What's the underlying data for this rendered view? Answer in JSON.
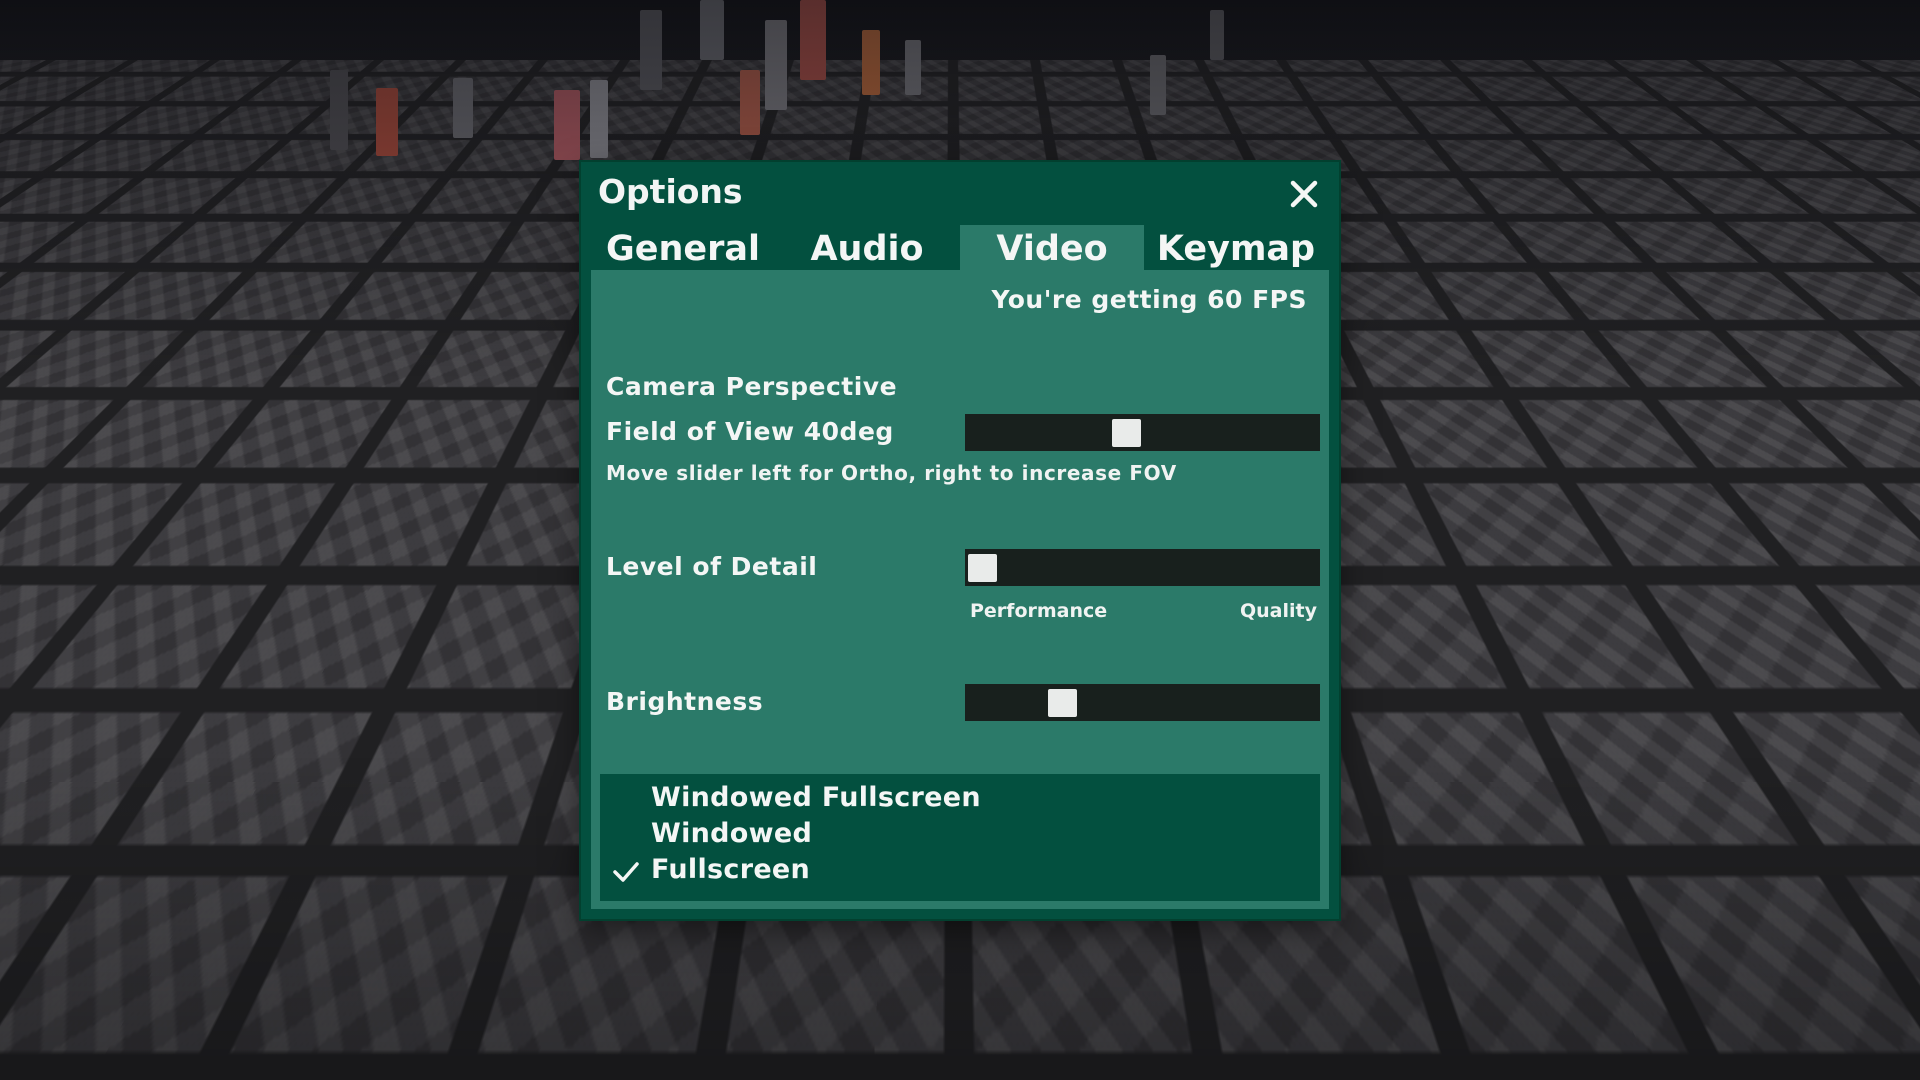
{
  "window": {
    "title": "Options",
    "close_icon": "close-icon"
  },
  "tabs": [
    {
      "label": "General",
      "active": false
    },
    {
      "label": "Audio",
      "active": false
    },
    {
      "label": "Video",
      "active": true
    },
    {
      "label": "Keymap",
      "active": false
    }
  ],
  "video": {
    "fps_text": "You're getting 60 FPS",
    "camera_perspective_label": "Camera Perspective",
    "fov_label": "Field of View 40deg",
    "fov_slider_value": 0.45,
    "fov_hint": "Move slider left for Ortho, right to increase FOV",
    "lod_label": "Level of Detail",
    "lod_slider_value": 0.0,
    "lod_min_label": "Performance",
    "lod_max_label": "Quality",
    "brightness_label": "Brightness",
    "brightness_slider_value": 0.25,
    "display_modes": [
      {
        "label": "Windowed Fullscreen",
        "selected": false
      },
      {
        "label": "Windowed",
        "selected": false
      },
      {
        "label": "Fullscreen",
        "selected": true
      }
    ]
  },
  "colors": {
    "window_bg": "#03503f",
    "panel_bg": "#2b7a69",
    "slider_track": "#18201d",
    "slider_thumb": "#e9ebea",
    "text": "#f4f6f5"
  }
}
